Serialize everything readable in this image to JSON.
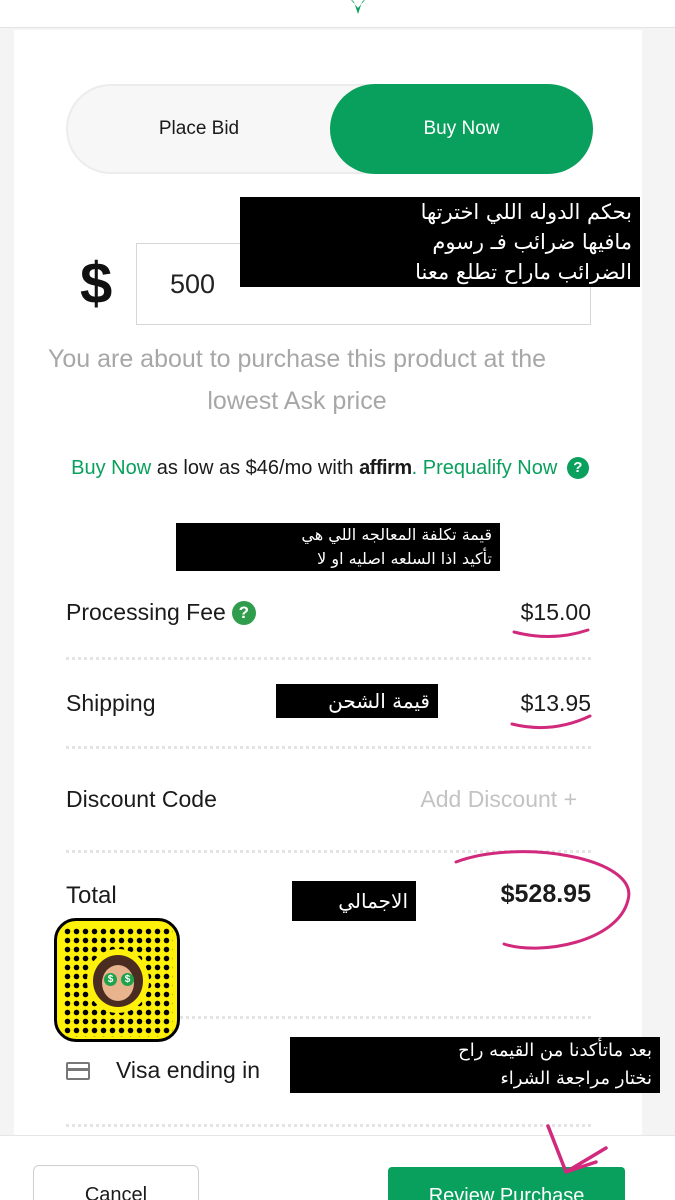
{
  "toggle": {
    "place_bid": "Place Bid",
    "buy_now": "Buy Now"
  },
  "price": {
    "currency_symbol": "$",
    "value": "500"
  },
  "description": "You are about to purchase this product at the lowest Ask price",
  "affirm": {
    "buy_now": "Buy Now",
    "text": " as low as $46/mo with ",
    "brand": "affirm",
    "prequalify": ". Prequalify Now",
    "help_icon": "?"
  },
  "rows": {
    "processing_fee": {
      "label": "Processing Fee",
      "value": "$15.00",
      "help_icon": "?"
    },
    "shipping": {
      "label": "Shipping",
      "value": "$13.95"
    },
    "discount": {
      "label": "Discount Code",
      "action": "Add Discount +"
    },
    "total": {
      "label": "Total",
      "value": "$528.95"
    }
  },
  "payment": {
    "label": "Visa ending in"
  },
  "footer": {
    "cancel": "Cancel",
    "review": "Review Purchase"
  },
  "notes": {
    "country_tax": [
      "بحكم الدوله اللي اخترتها",
      "مافيها ضرائب فـ رسوم",
      "الضرائب ماراح تطلع معنا"
    ],
    "processing": [
      "قيمة تكلفة المعالجه اللي هي",
      "تأكيد اذا السلعه اصليه او لا"
    ],
    "shipping": [
      "قيمة الشحن"
    ],
    "total": [
      "الاجمالي"
    ],
    "review": [
      "بعد ماتأكدنا من القيمه راح",
      "نختار مراجعة الشراء"
    ]
  },
  "icons": {
    "logo": "star-logo-icon",
    "card": "credit-card-icon",
    "snapcode": "snapcode-icon"
  },
  "colors": {
    "accent": "#08a05c",
    "annotation": "#d1297c"
  }
}
